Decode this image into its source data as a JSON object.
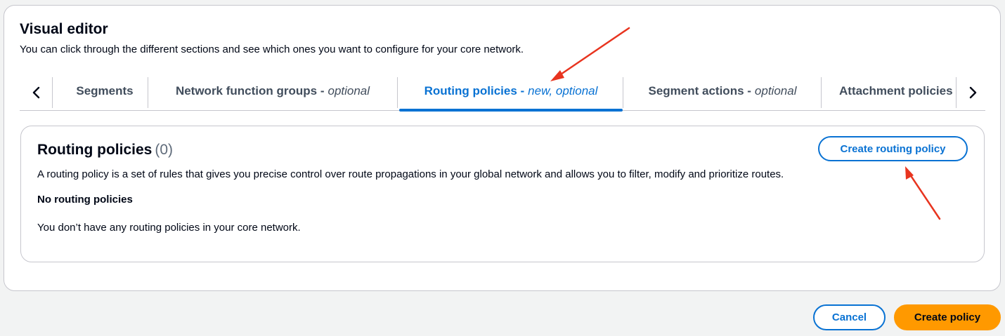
{
  "editor": {
    "title": "Visual editor",
    "description": "You can click through the different sections and see which ones you want to configure for your core network."
  },
  "tabs": {
    "scroll_left": "‹",
    "scroll_right": "›",
    "items": [
      {
        "label": "Segments",
        "suffix": ""
      },
      {
        "label": "Network function groups -",
        "suffix": "optional"
      },
      {
        "label": "Routing policies -",
        "suffix": "new, optional"
      },
      {
        "label": "Segment actions -",
        "suffix": "optional"
      },
      {
        "label": "Attachment policies",
        "suffix": ""
      }
    ],
    "active_index": 2
  },
  "routing": {
    "title": "Routing policies",
    "count": "(0)",
    "create_button": "Create routing policy",
    "description": "A routing policy is a set of rules that gives you precise control over route propagations in your global network and allows you to filter, modify and prioritize routes.",
    "empty_title": "No routing policies",
    "empty_description": "You don’t have any routing policies in your core network."
  },
  "footer": {
    "cancel_label": "Cancel",
    "create_label": "Create policy"
  },
  "colors": {
    "accent": "#0972d3",
    "primary_button": "#ff9900",
    "annotation_arrow": "#e8341f"
  }
}
